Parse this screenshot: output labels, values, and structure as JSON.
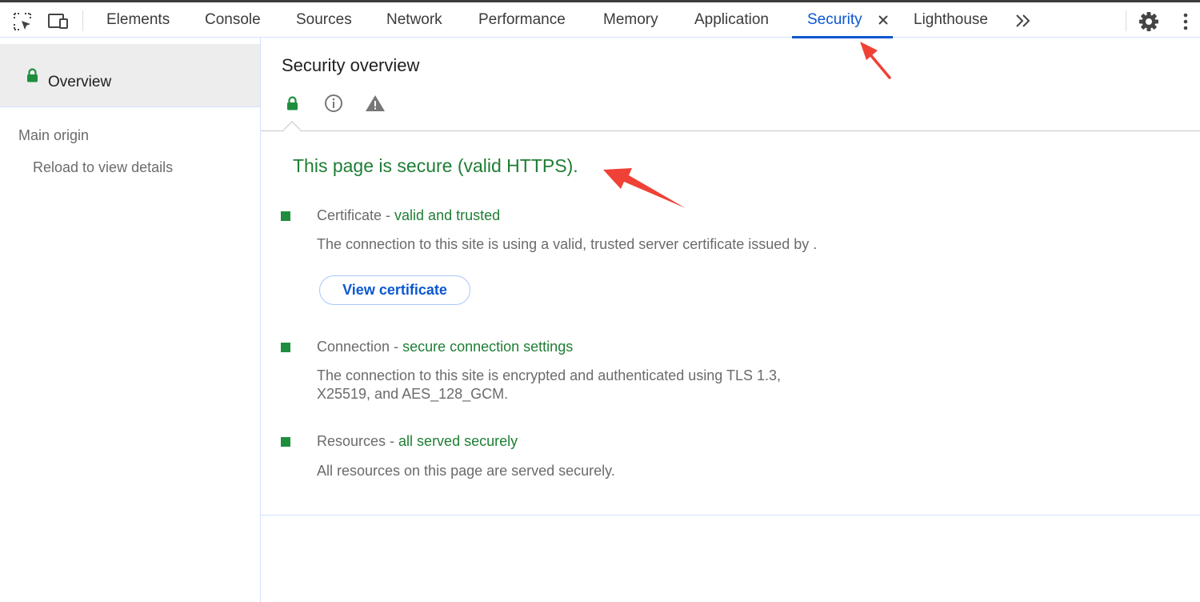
{
  "toolbar": {
    "inspect_icon": "element-picker-icon",
    "device_icon": "device-toolbar-icon",
    "tabs": [
      {
        "label": "Elements"
      },
      {
        "label": "Console"
      },
      {
        "label": "Sources"
      },
      {
        "label": "Network"
      },
      {
        "label": "Performance"
      },
      {
        "label": "Memory"
      },
      {
        "label": "Application"
      },
      {
        "label": "Security",
        "active": true
      },
      {
        "label": "Lighthouse"
      }
    ],
    "more_tabs_glyph": "»",
    "settings_icon": "gear-icon",
    "menu_icon": "kebab-menu-icon"
  },
  "sidebar": {
    "overview_label": "Overview",
    "main_origin_label": "Main origin",
    "reload_label": "Reload to view details"
  },
  "main": {
    "title": "Security overview",
    "summary": "This page is secure (valid HTTPS).",
    "items": [
      {
        "name": "Certificate",
        "separator": " - ",
        "status": "valid and trusted",
        "description": "The connection to this site is using a valid, trusted server certificate issued by ."
      },
      {
        "name": "Connection",
        "separator": " - ",
        "status": "secure connection settings",
        "description": "The connection to this site is encrypted and authenticated using TLS 1.3, X25519, and AES_128_GCM."
      },
      {
        "name": "Resources",
        "separator": " - ",
        "status": "all served securely",
        "description": "All resources on this page are served securely."
      }
    ],
    "view_certificate_label": "View certificate"
  },
  "colors": {
    "accent": "#0b57d0",
    "secure_green": "#1e7e34",
    "bullet_green": "#1e8e3e",
    "annotation_red": "#ef4136"
  }
}
